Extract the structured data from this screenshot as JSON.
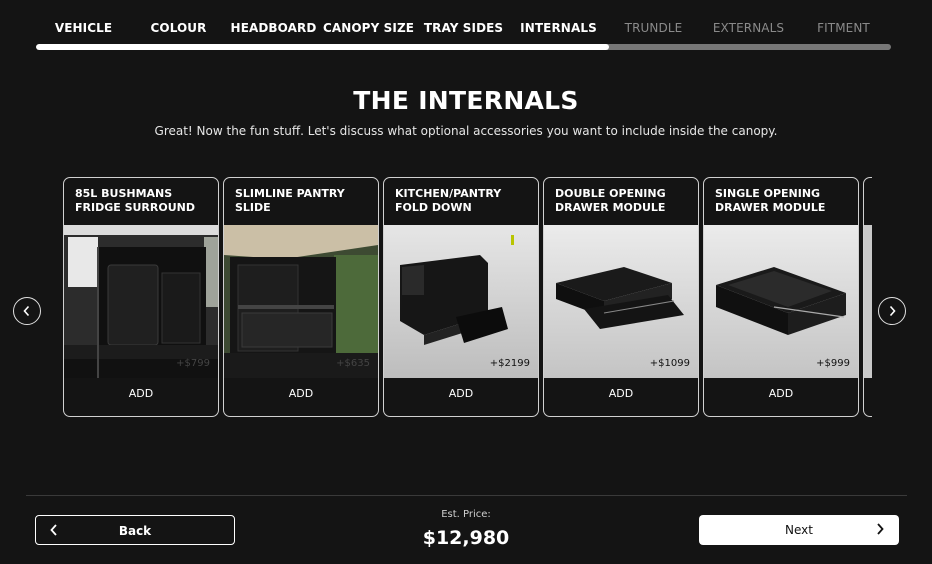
{
  "steps": [
    {
      "label": "VEHICLE",
      "state": "done"
    },
    {
      "label": "COLOUR",
      "state": "done"
    },
    {
      "label": "HEADBOARD",
      "state": "done"
    },
    {
      "label": "CANOPY SIZE",
      "state": "done"
    },
    {
      "label": "TRAY SIDES",
      "state": "done"
    },
    {
      "label": "INTERNALS",
      "state": "current"
    },
    {
      "label": "TRUNDLE",
      "state": "todo"
    },
    {
      "label": "EXTERNALS",
      "state": "todo"
    },
    {
      "label": "FITMENT",
      "state": "todo"
    }
  ],
  "progress_fraction": 0.67,
  "page": {
    "title": "THE INTERNALS",
    "subtitle": "Great! Now the fun stuff. Let's discuss what optional accessories you want to include inside the canopy."
  },
  "cards": [
    {
      "title": "85L BUSHMANS FRIDGE SURROUND",
      "price": "+$799",
      "add_label": "ADD"
    },
    {
      "title": "SLIMLINE PANTRY SLIDE",
      "price": "+$635",
      "add_label": "ADD"
    },
    {
      "title": "KITCHEN/PANTRY FOLD DOWN",
      "price": "+$2199",
      "add_label": "ADD"
    },
    {
      "title": "DOUBLE OPENING DRAWER MODULE",
      "price": "+$1099",
      "add_label": "ADD"
    },
    {
      "title": "SINGLE OPENING DRAWER MODULE",
      "price": "+$999",
      "add_label": "ADD"
    }
  ],
  "icons": {
    "prev": "chevron-left-icon",
    "next": "chevron-right-icon"
  },
  "footer": {
    "back_label": "Back",
    "next_label": "Next",
    "price_label": "Est. Price:",
    "price_value": "$12,980"
  },
  "colors": {
    "background": "#141414",
    "accent": "#ffffff",
    "inactive_step": "#8a8a8a",
    "track": "#777777"
  }
}
